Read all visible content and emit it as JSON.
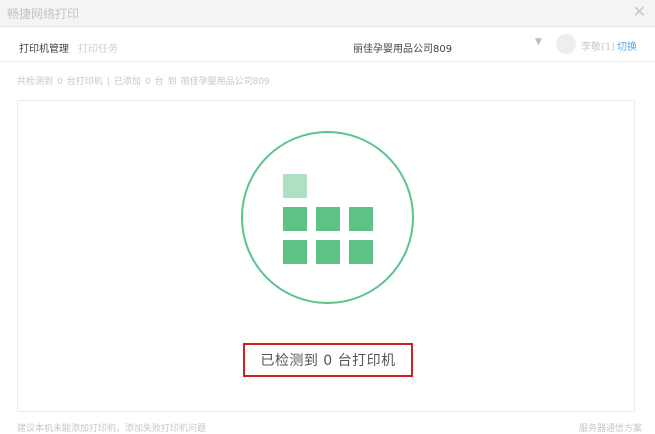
{
  "window": {
    "title": "畅捷网络打印",
    "close_icon": "close-icon"
  },
  "header": {
    "tabs": [
      {
        "label": "打印机管理",
        "active": true
      },
      {
        "label": "打印任务",
        "active": false
      }
    ],
    "store_name": "丽佳孕婴用品公司809",
    "dropdown_icon": "chevron-down-icon",
    "user_name": "李敬(1)",
    "switch_label": "切换"
  },
  "summary": {
    "prefix": "共检测到",
    "detected_count": "0",
    "detected_unit": "台打印机",
    "separator": "|",
    "added_prefix": "已添加",
    "added_count": "0",
    "added_unit": "台",
    "to": "到",
    "store_name": "丽佳孕婴用品公司809"
  },
  "main": {
    "status_text": "已检测到  0  台打印机"
  },
  "footer": {
    "left_text": "建议本机未能添加打印机，添加失败打印机问题",
    "right_text": "服务器通信方案"
  },
  "colors": {
    "accent_green": "#5dc385",
    "highlight_red": "#cf1f1f",
    "link_blue": "#57a9ec"
  }
}
